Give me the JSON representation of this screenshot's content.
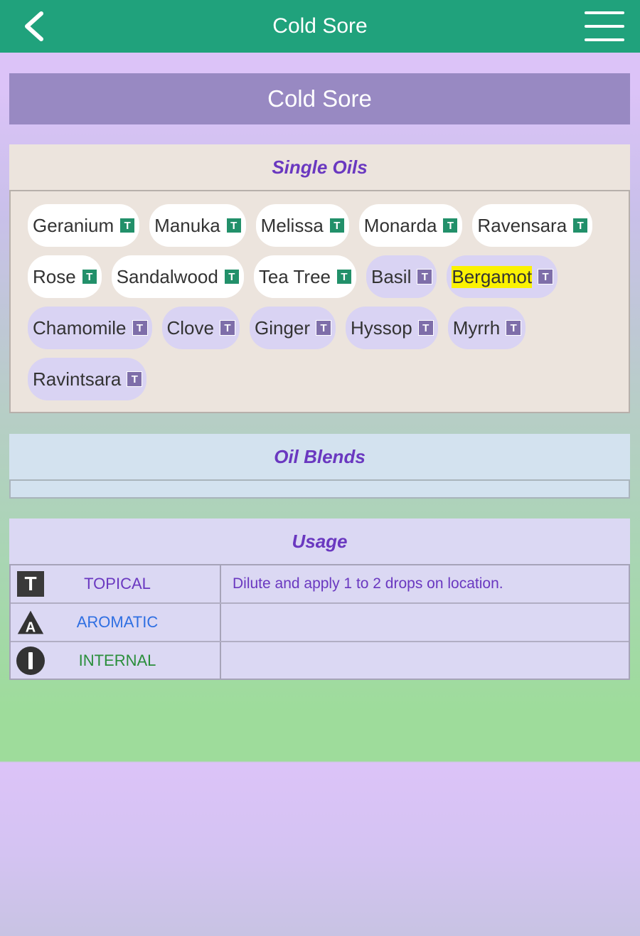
{
  "app": {
    "title": "Cold Sore"
  },
  "page": {
    "header": "Cold Sore"
  },
  "single_oils": {
    "title": "Single Oils",
    "items": [
      {
        "name": "Geranium",
        "tag": "T",
        "style": "white"
      },
      {
        "name": "Manuka",
        "tag": "T",
        "style": "white"
      },
      {
        "name": "Melissa",
        "tag": "T",
        "style": "white"
      },
      {
        "name": "Monarda",
        "tag": "T",
        "style": "white"
      },
      {
        "name": "Ravensara",
        "tag": "T",
        "style": "white"
      },
      {
        "name": "Rose",
        "tag": "T",
        "style": "white"
      },
      {
        "name": "Sandalwood",
        "tag": "T",
        "style": "white"
      },
      {
        "name": "Tea Tree",
        "tag": "T",
        "style": "white"
      },
      {
        "name": "Basil",
        "tag": "T",
        "style": "lavender"
      },
      {
        "name": "Bergamot",
        "tag": "T",
        "style": "lavender",
        "highlighted": true
      },
      {
        "name": "Chamomile",
        "tag": "T",
        "style": "lavender"
      },
      {
        "name": "Clove",
        "tag": "T",
        "style": "lavender"
      },
      {
        "name": "Ginger",
        "tag": "T",
        "style": "lavender"
      },
      {
        "name": "Hyssop",
        "tag": "T",
        "style": "lavender"
      },
      {
        "name": "Myrrh",
        "tag": "T",
        "style": "lavender"
      },
      {
        "name": "Ravintsara",
        "tag": "T",
        "style": "lavender"
      }
    ]
  },
  "oil_blends": {
    "title": "Oil Blends",
    "items": []
  },
  "usage": {
    "title": "Usage",
    "rows": [
      {
        "icon": "topical-t-icon",
        "icon_glyph": "T",
        "label": "TOPICAL",
        "description": "Dilute and apply 1 to 2 drops on location."
      },
      {
        "icon": "aromatic-a-icon",
        "icon_glyph": "A",
        "label": "AROMATIC",
        "description": ""
      },
      {
        "icon": "internal-i-icon",
        "icon_glyph": "I",
        "label": "INTERNAL",
        "description": ""
      }
    ]
  },
  "colors": {
    "topbar": "#20a27c",
    "header": "#9889c2",
    "section_title": "#6a38c0",
    "highlight": "#fbf202",
    "topical": "#6a38c0",
    "aromatic": "#2f6fe2",
    "internal": "#2a8e3b"
  }
}
